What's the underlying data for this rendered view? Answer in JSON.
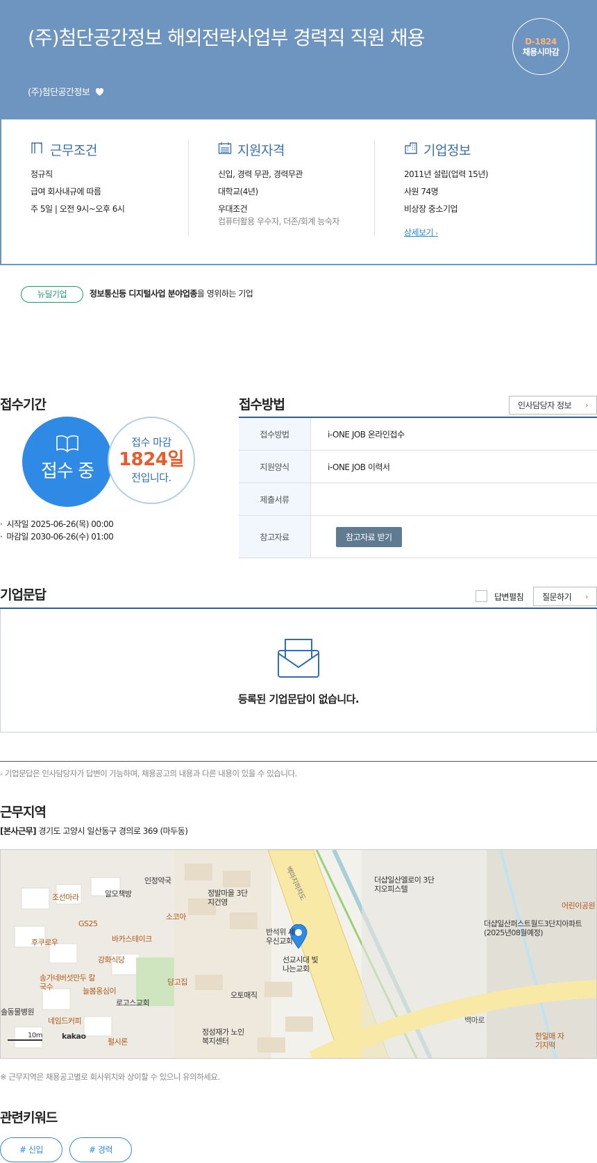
{
  "header": {
    "title": "(주)첨단공간정보 해외전략사업부 경력직 직원 채용",
    "company": "(주)첨단공간정보",
    "dday": "D-1824",
    "deadline_type": "채용시마감",
    "bg_color": "#6d95c0"
  },
  "conditions": {
    "work": {
      "title": "근무조건",
      "items": [
        "정규직",
        "급여 회사내규에 따름",
        "주 5일 | 오전 9시~오후 6시"
      ]
    },
    "qual": {
      "title": "지원자격",
      "items": [
        "신입, 경력 무관, 경력무관",
        "대학교(4년)",
        "우대조건"
      ],
      "preferred": "컴퓨터활용 우수자, 더존/회계 능숙자"
    },
    "company": {
      "title": "기업정보",
      "items": [
        "2011년 설립(업력 15년)",
        "사원 74명",
        "비상장 중소기업"
      ],
      "link": "상세보기"
    }
  },
  "badge": "뉴딜기업",
  "industry": {
    "bold": "정보통신등 디지털사업 분야업종",
    "rest": "을 영위하는 기업"
  },
  "period": {
    "title": "접수기간",
    "status": "접수 중",
    "remain_label": "접수 마감",
    "remain_days": "1824일",
    "remain_suffix": "전입니다.",
    "start": "시작일 2025-06-26(목) 00:00",
    "end": "마감일 2030-06-26(수) 01:00"
  },
  "method": {
    "title": "접수방법",
    "hr_button": "인사담당자 정보",
    "rows": [
      {
        "label": "접수방법",
        "value": "i-ONE JOB 온라인접수"
      },
      {
        "label": "지원양식",
        "value": "i-ONE JOB 이력서"
      },
      {
        "label": "제출서류",
        "value": ""
      },
      {
        "label": "참고자료",
        "value": ""
      }
    ],
    "download_button": "참고자료 받기"
  },
  "qa": {
    "title": "기업문답",
    "toggle_label": "답변펼침",
    "ask_button": "질문하기",
    "empty": "등록된 기업문답이 없습니다.",
    "note": "- 기업문답은 인사담당자가 답변이 가능하며, 채용공고의 내용과 다른 내용이 있을 수 있습니다."
  },
  "location": {
    "title": "근무지역",
    "type": "[본사근무]",
    "address": "경기도 고양시 일산동구 경의로 369 (마두동)",
    "note": "※ 근무지역은 채용공고별로 회사위치와 상이할 수 있으니 유의하세요.",
    "map": {
      "scale": "10m",
      "provider": "kakao",
      "labels": [
        "인정약국",
        "알모책방",
        "정발마을 3단지건영",
        "더샵일산엘로이 3단지오피스텔",
        "조선마라",
        "소코아",
        "반석위 세우신교회",
        "더샵일산퍼스트월드3단지아파트 (2025년08월예정)",
        "GS25",
        "바카스테이크",
        "후쿠로우",
        "강화식당",
        "선교시대 빛나는교회",
        "송가네버섯만두 칼국수",
        "늘봄옹심이",
        "당고집",
        "오토매직",
        "로고스교회",
        "솔동물병원",
        "네임드커피",
        "펄시론",
        "정성재가 노인복지센터",
        "백마로",
        "백마지하차도",
        "어린이공원",
        "한일애 자기지떡"
      ]
    }
  },
  "keywords": {
    "title": "관련키워드",
    "items": [
      "# 신입",
      "# 경력"
    ]
  }
}
